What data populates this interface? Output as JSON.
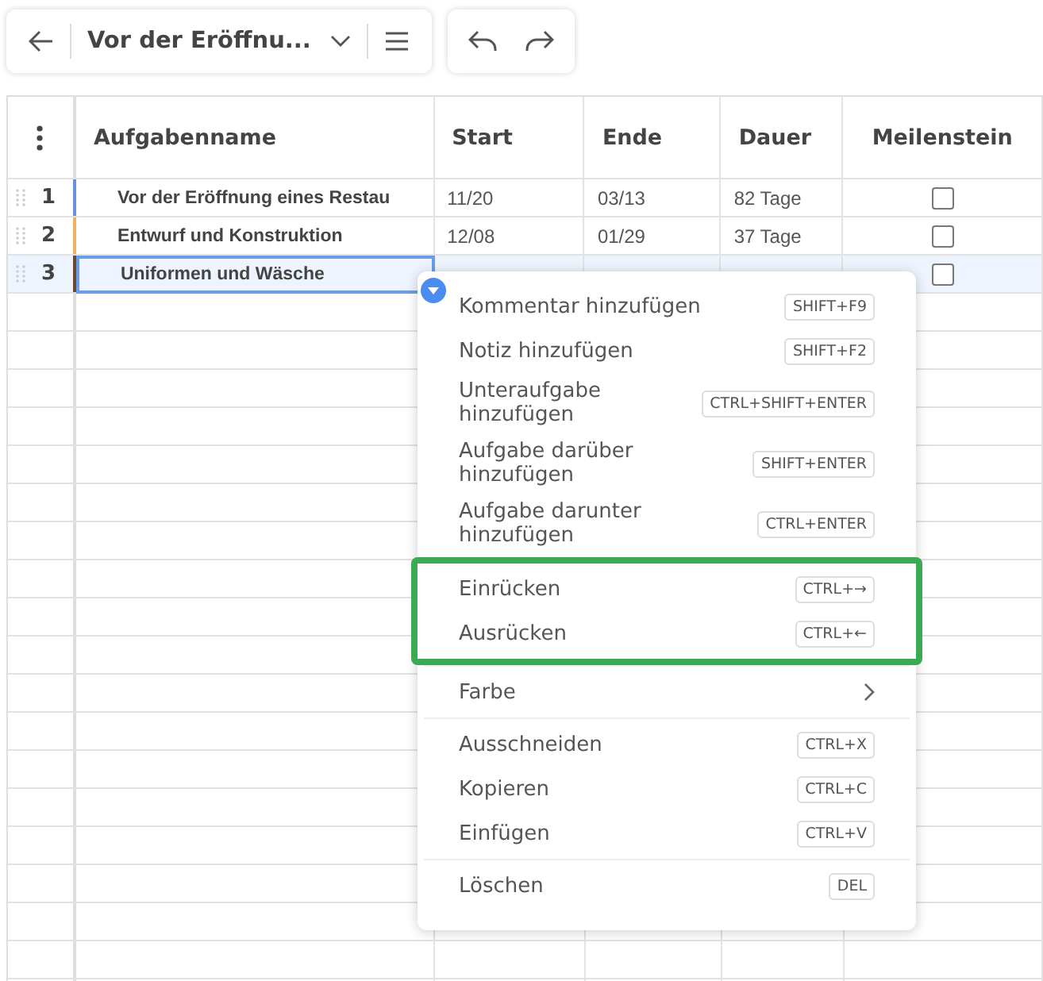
{
  "toolbar": {
    "title": "Vor der Eröffnu..."
  },
  "table": {
    "columns": [
      "Aufgabenname",
      "Start",
      "Ende",
      "Dauer",
      "Meilenstein"
    ],
    "rows": [
      {
        "number": "1",
        "name": "Vor der Eröffnung eines Restau",
        "start": "11/20",
        "end": "03/13",
        "duration": "82 Tage",
        "milestone": false,
        "color": "#6b8fe0",
        "selected": false
      },
      {
        "number": "2",
        "name": "Entwurf und Konstruktion",
        "start": "12/08",
        "end": "01/29",
        "duration": "37 Tage",
        "milestone": false,
        "color": "#f0b060",
        "selected": false
      },
      {
        "number": "3",
        "name": "Uniformen und Wäsche",
        "milestone": false,
        "color": "#6b4a2a",
        "selected": true
      }
    ]
  },
  "context_menu": {
    "groups": [
      {
        "highlighted": false,
        "items": [
          {
            "kind": "action",
            "label": "Kommentar hinzufügen",
            "shortcut": "SHIFT+F9"
          },
          {
            "kind": "action",
            "label": "Notiz hinzufügen",
            "shortcut": "SHIFT+F2"
          },
          {
            "kind": "action",
            "label": "Unteraufgabe hinzufügen",
            "shortcut": "CTRL+SHIFT+ENTER"
          },
          {
            "kind": "action",
            "label": "Aufgabe darüber hinzufügen",
            "shortcut": "SHIFT+ENTER"
          },
          {
            "kind": "action",
            "label": "Aufgabe darunter hinzufügen",
            "shortcut": "CTRL+ENTER"
          }
        ]
      },
      {
        "highlighted": true,
        "items": [
          {
            "kind": "action",
            "label": "Einrücken",
            "shortcut": "CTRL+→"
          },
          {
            "kind": "action",
            "label": "Ausrücken",
            "shortcut": "CTRL+←"
          }
        ]
      },
      {
        "highlighted": false,
        "items": [
          {
            "kind": "submenu",
            "label": "Farbe"
          }
        ]
      },
      {
        "highlighted": false,
        "items": [
          {
            "kind": "action",
            "label": "Ausschneiden",
            "shortcut": "CTRL+X"
          },
          {
            "kind": "action",
            "label": "Kopieren",
            "shortcut": "CTRL+C"
          },
          {
            "kind": "action",
            "label": "Einfügen",
            "shortcut": "CTRL+V"
          }
        ]
      },
      {
        "highlighted": false,
        "items": [
          {
            "kind": "action",
            "label": "Löschen",
            "shortcut": "DEL"
          }
        ]
      }
    ]
  }
}
